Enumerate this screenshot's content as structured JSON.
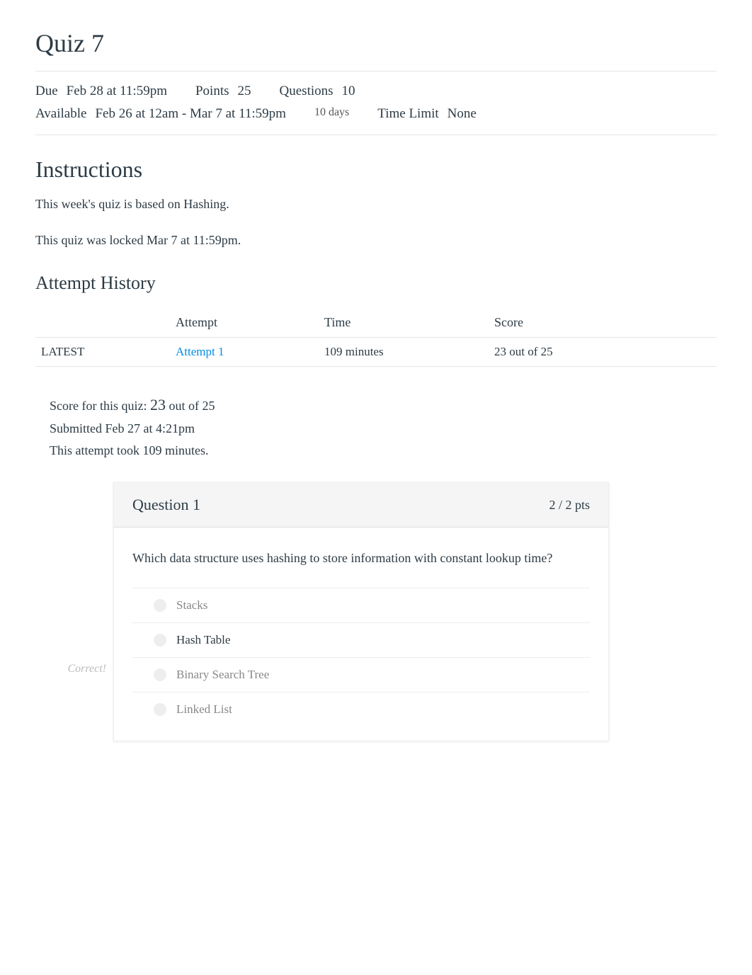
{
  "title": "Quiz 7",
  "meta": {
    "due_label": "Due",
    "due_value": "Feb 28 at 11:59pm",
    "points_label": "Points",
    "points_value": "25",
    "questions_label": "Questions",
    "questions_value": "10",
    "available_label": "Available",
    "available_value": "Feb 26 at 12am - Mar 7 at 11:59pm",
    "available_sub": "10 days",
    "timelimit_label": "Time Limit",
    "timelimit_value": "None"
  },
  "instructions": {
    "heading": "Instructions",
    "text": "This week's quiz is based on Hashing."
  },
  "locked_text": "This quiz was locked Mar 7 at 11:59pm.",
  "attempt_history": {
    "heading": "Attempt History",
    "headers": {
      "status": "",
      "attempt": "Attempt",
      "time": "Time",
      "score": "Score"
    },
    "row": {
      "status": "LATEST",
      "attempt": "Attempt 1",
      "time": "109 minutes",
      "score": "23 out of 25"
    }
  },
  "score_block": {
    "score_label": "Score for this quiz:",
    "score_value": "23",
    "score_suffix": "out of 25",
    "submitted": "Submitted Feb 27 at 4:21pm",
    "duration": "This attempt took 109 minutes."
  },
  "question": {
    "title": "Question 1",
    "pts": "2 / 2 pts",
    "text": "Which data structure uses hashing to store information with constant lookup time?",
    "correct_label": "Correct!",
    "answers": [
      {
        "text": "Stacks",
        "selected": false
      },
      {
        "text": "Hash Table",
        "selected": true
      },
      {
        "text": "Binary Search Tree",
        "selected": false
      },
      {
        "text": "Linked List",
        "selected": false
      }
    ]
  }
}
